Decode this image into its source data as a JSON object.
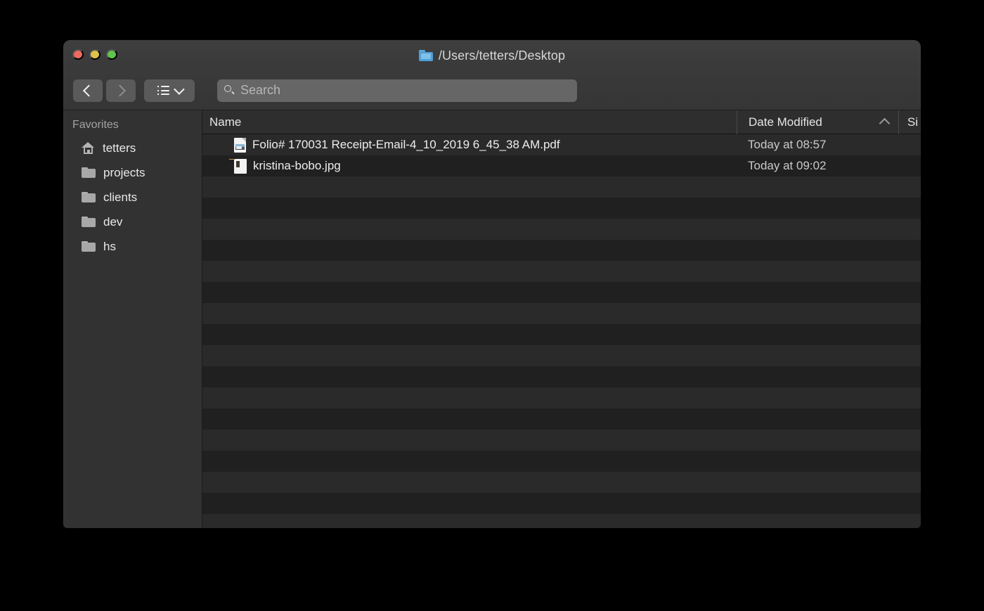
{
  "window": {
    "title": "/Users/tetters/Desktop",
    "title_icon": "blue-folder-icon",
    "traffic_lights": {
      "close_label": "close",
      "minimize_label": "minimize",
      "maximize_label": "maximize",
      "close_color": "#ee6a5f",
      "minimize_color": "#e0c24a",
      "maximize_color": "#61c34d"
    }
  },
  "toolbar": {
    "back_icon": "chevron-left-icon",
    "forward_icon": "chevron-right-icon",
    "view_icon": "list-view-icon",
    "view_chevron_icon": "chevron-down-icon",
    "search": {
      "icon": "search-icon",
      "placeholder": "Search",
      "value": ""
    }
  },
  "sidebar": {
    "header": "Favorites",
    "items": [
      {
        "label": "tetters",
        "icon": "home-icon"
      },
      {
        "label": "projects",
        "icon": "folder-icon"
      },
      {
        "label": "clients",
        "icon": "folder-icon"
      },
      {
        "label": "dev",
        "icon": "folder-icon"
      },
      {
        "label": "hs",
        "icon": "folder-icon"
      }
    ]
  },
  "filelist": {
    "columns": {
      "name": "Name",
      "date_modified": "Date Modified",
      "size": "Si",
      "sort_column": "Date Modified",
      "sort_direction": "ascending",
      "sort_icon": "caret-up-icon"
    },
    "rows": [
      {
        "name": "Folio# 170031 Receipt-Email-4_10_2019 6_45_38 AM.pdf",
        "date_modified": "Today at 08:57",
        "size": "",
        "icon": "pdf-file-icon"
      },
      {
        "name": "kristina-bobo.jpg",
        "date_modified": "Today at 09:02",
        "size": "",
        "icon": "jpg-file-icon"
      }
    ],
    "empty_row_count": 18
  }
}
